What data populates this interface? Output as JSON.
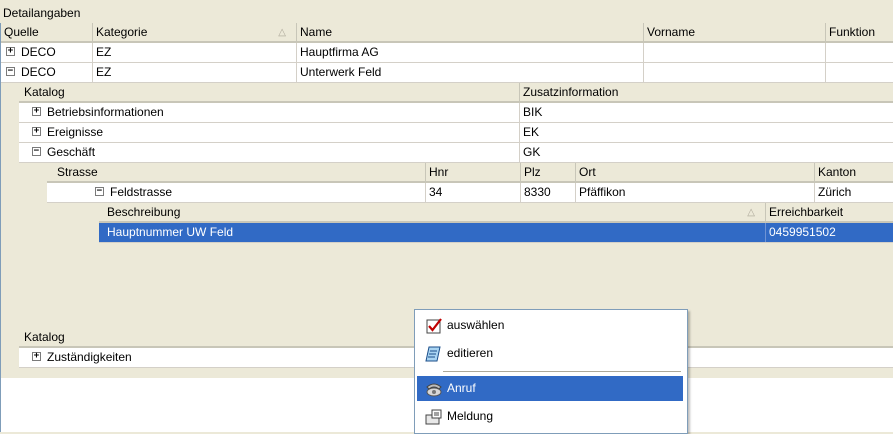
{
  "panel_title": "Detailangaben",
  "level1": {
    "headers": {
      "quelle": "Quelle",
      "kategorie": "Kategorie",
      "name": "Name",
      "vorname": "Vorname",
      "funktion": "Funktion"
    },
    "rows": [
      {
        "toggle": "+",
        "quelle": "DECO",
        "kategorie": "EZ",
        "name": "Hauptfirma AG",
        "vorname": "",
        "funktion": ""
      },
      {
        "toggle": "−",
        "quelle": "DECO",
        "kategorie": "EZ",
        "name": "Unterwerk Feld",
        "vorname": "",
        "funktion": ""
      }
    ]
  },
  "level2": {
    "headers": {
      "katalog": "Katalog",
      "zusatz": "Zusatzinformation"
    },
    "rows": [
      {
        "toggle": "+",
        "katalog": "Betriebsinformationen",
        "zusatz": "BIK"
      },
      {
        "toggle": "+",
        "katalog": "Ereignisse",
        "zusatz": "EK"
      },
      {
        "toggle": "−",
        "katalog": "Geschäft",
        "zusatz": "GK"
      }
    ],
    "second_header": "Katalog",
    "second_rows": [
      {
        "toggle": "+",
        "katalog": "Zuständigkeiten"
      }
    ]
  },
  "level3": {
    "headers": {
      "strasse": "Strasse",
      "hnr": "Hnr",
      "plz": "Plz",
      "ort": "Ort",
      "kanton": "Kanton"
    },
    "rows": [
      {
        "toggle": "−",
        "strasse": "Feldstrasse",
        "hnr": "34",
        "plz": "8330",
        "ort": "Pfäffikon",
        "kanton": "Zürich"
      }
    ]
  },
  "level4": {
    "headers": {
      "beschreibung": "Beschreibung",
      "erreichbarkeit": "Erreichbarkeit"
    },
    "rows": [
      {
        "beschreibung": "Hauptnummer UW Feld",
        "erreichbarkeit": "0459951502"
      }
    ]
  },
  "context_menu": {
    "items": [
      {
        "label": "auswählen",
        "icon": "checkbox-icon"
      },
      {
        "label": "editieren",
        "icon": "edit-icon"
      },
      {
        "label": "Anruf",
        "icon": "phone-icon"
      },
      {
        "label": "Meldung",
        "icon": "message-icon"
      }
    ]
  },
  "colors": {
    "selection": "#316ac5",
    "header_bg": "#ece9d8"
  }
}
